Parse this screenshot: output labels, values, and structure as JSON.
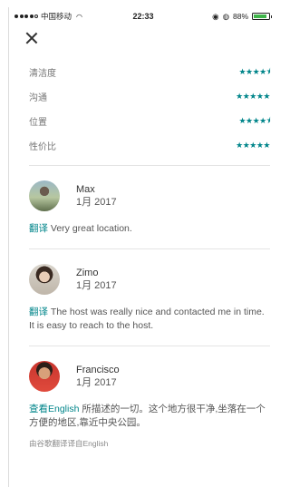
{
  "status_bar": {
    "carrier": "中国移动",
    "time": "22:33",
    "battery": "88%",
    "battery_level": 0.88,
    "signal_dots_filled": 4,
    "signal_dots_total": 5
  },
  "nav": {
    "close_icon": "close-icon"
  },
  "ratings": [
    {
      "label": "清洁度",
      "stars": "★★★★⯨",
      "value": 4.5
    },
    {
      "label": "沟通",
      "stars": "★★★★★",
      "value": 5
    },
    {
      "label": "位置",
      "stars": "★★★★⯨",
      "value": 4.5
    },
    {
      "label": "性价比",
      "stars": "★★★★★",
      "value": 5
    }
  ],
  "reviews": [
    {
      "name": "Max",
      "date": "1月 2017",
      "link": "翻译",
      "text": " Very great location.",
      "note": ""
    },
    {
      "name": "Zimo",
      "date": "1月 2017",
      "link": "翻译",
      "text": " The host was really nice and contacted me in time. It is easy to reach to the host.",
      "note": ""
    },
    {
      "name": "Francisco",
      "date": "1月 2017",
      "link": "查看English",
      "text": " 所描述的一切。这个地方很干净,坐落在一个方便的地区,靠近中央公园。",
      "note": "由谷歌翻译译自English"
    }
  ],
  "colors": {
    "accent": "#00858a",
    "battery": "#3fb54a",
    "text": "#484848"
  }
}
